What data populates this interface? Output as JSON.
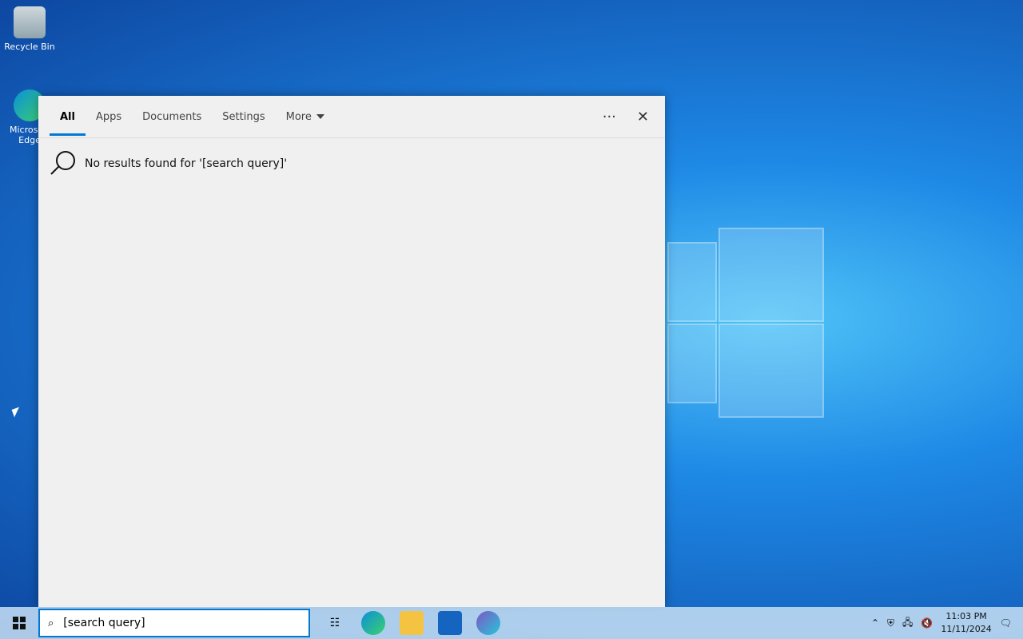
{
  "desktop": {
    "icons": [
      {
        "label": "Recycle Bin"
      },
      {
        "label": "Microsoft Edge"
      }
    ]
  },
  "search_panel": {
    "tabs": [
      "All",
      "Apps",
      "Documents",
      "Settings",
      "More"
    ],
    "active_tab": "All",
    "message": "No results found for '[search query]'"
  },
  "taskbar": {
    "search_value": "[search query]",
    "apps": [
      "task-view",
      "edge",
      "file-explorer",
      "store",
      "copilot"
    ],
    "clock": {
      "time": "11:03 PM",
      "date": "11/11/2024"
    }
  },
  "colors": {
    "accent": "#0078d4"
  }
}
